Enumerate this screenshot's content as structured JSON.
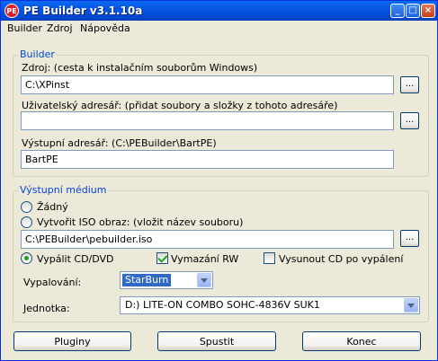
{
  "window": {
    "title": "PE Builder v3.1.10a",
    "icon_text": "PE"
  },
  "titlebar_buttons": {
    "minimize": "_",
    "maximize": "□",
    "close": "×"
  },
  "menu": [
    "Builder",
    "Zdroj",
    "Nápověda"
  ],
  "builder_group": {
    "legend": "Builder",
    "source_label": "Zdroj: (cesta k instalačním souborům Windows)",
    "source_value": "C:\\XPinst",
    "custom_label": "Uživatelský adresář: (přidat soubory a složky z tohoto adresáře)",
    "custom_value": "",
    "output_label": "Výstupní adresář: (C:\\PEBuilder\\BartPE)",
    "output_value": "BartPE",
    "browse": "..."
  },
  "media_group": {
    "legend": "Výstupní médium",
    "none_label": "Žádný",
    "iso_label": "Vytvořit ISO obraz: (vložit název souboru)",
    "iso_value": "C:\\PEBuilder\\pebuilder.iso",
    "burn_label": "Vypálit CD/DVD",
    "erase_rw_label": "Vymazání RW",
    "eject_label": "Vysunout CD po vypálení",
    "burning_label": "Vypalování:",
    "burning_value": "StarBurn",
    "drive_label": "Jednotka:",
    "drive_value": "D:) LITE-ON  COMBO SOHC-4836V SUK1",
    "browse": "...",
    "selected_option": "burn",
    "erase_rw_checked": true,
    "eject_checked": false
  },
  "buttons": {
    "plugins": "Pluginy",
    "start": "Spustit",
    "exit": "Konec"
  }
}
